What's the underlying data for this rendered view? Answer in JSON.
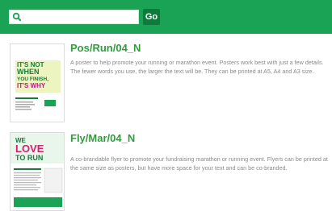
{
  "search": {
    "value": "",
    "placeholder": "",
    "go_label": "Go",
    "icon": "search-icon"
  },
  "results": [
    {
      "title": "Pos/Run/04_N",
      "description": "A poster to help promote your running or marathon event. Posters work best with just a few details. The fewer words you use, the larger the text will be. They can be printed at A5, A4 and A3 size.",
      "thumb_text": [
        "IT'S NOT",
        "WHEN",
        "YOU FINISH,",
        "IT'S WHY"
      ]
    },
    {
      "title": "Fly/Mar/04_N",
      "description": "A co-brandable flyer to promote your fundraising marathon or running event. Flyers can be printed at the same size as posters, but have more space for your text and can be co-branded.",
      "thumb_text": [
        "WE",
        "LOVE",
        "TO RUN"
      ]
    }
  ],
  "colors": {
    "header": "#1aa354",
    "button": "#0f7a3c",
    "title": "#2e9e3a",
    "text": "#8a8a8a"
  }
}
